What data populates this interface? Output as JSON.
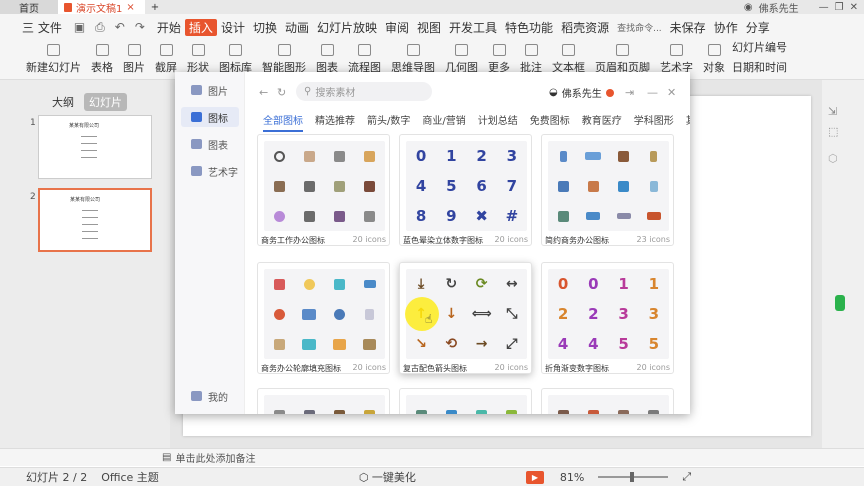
{
  "titlebar": {
    "home_tab": "首页",
    "doc_tab": "演示文稿1",
    "user": "佛系先生"
  },
  "menubar": {
    "file": "三 文件",
    "items": [
      "开始",
      "插入",
      "设计",
      "切换",
      "动画",
      "幻灯片放映",
      "审阅",
      "视图",
      "开发工具",
      "特色功能",
      "稻壳资源"
    ],
    "active": "插入",
    "search_placeholder": "查找命令...",
    "unsaved": "未保存",
    "collab": "协作",
    "share": "分享"
  },
  "ribbon": {
    "items": [
      "新建幻灯片",
      "表格",
      "图片",
      "截屏",
      "形状",
      "图标库",
      "智能图形",
      "图表",
      "流程图",
      "思维导图",
      "几何图",
      "更多",
      "批注",
      "文本框",
      "页眉和页脚",
      "艺术字",
      "对象"
    ],
    "right_top": "幻灯片编号",
    "right_bottom": "日期和时间"
  },
  "left_panel": {
    "tab_outline": "大纲",
    "tab_slides": "幻灯片",
    "thumb_title": "某某有限公司"
  },
  "notes": {
    "placeholder": "单击此处添加备注"
  },
  "status": {
    "slide_info": "幻灯片 2 / 2",
    "theme": "Office 主题",
    "beautify": "一键美化",
    "zoom": "81%"
  },
  "dialog": {
    "sidebar": [
      "图片",
      "图标",
      "图表",
      "艺术字"
    ],
    "sidebar_active": "图标",
    "sidebar_bottom": "我的",
    "search_placeholder": "搜索素材",
    "user": "佛系先生",
    "categories": [
      "全部图标",
      "精选推荐",
      "箭头/数字",
      "商业/营销",
      "计划总结",
      "免费图标",
      "教育医疗",
      "学科图形",
      "其他"
    ],
    "category_active": "全部图标",
    "cards": [
      {
        "name": "商务工作办公图标",
        "count": "20 icons",
        "kind": "office"
      },
      {
        "name": "蓝色晕染立体数字图标",
        "count": "20 icons",
        "kind": "digits",
        "glyphs": [
          "0",
          "1",
          "2",
          "3",
          "4",
          "5",
          "6",
          "7",
          "8",
          "9",
          "✖",
          "#"
        ]
      },
      {
        "name": "简约商务办公图标",
        "count": "23 icons",
        "kind": "biz"
      },
      {
        "name": "商务办公轮廓填充图标",
        "count": "20 icons",
        "kind": "outline"
      },
      {
        "name": "复古配色箭头图标",
        "count": "20 icons",
        "kind": "arrows",
        "glyphs": [
          "⤓",
          "↻",
          "⟳",
          "↔",
          "↑",
          "↓",
          "⟺",
          "⤡",
          "↘",
          "⟲",
          "→",
          "⤢"
        ]
      },
      {
        "name": "折角渐变数字图标",
        "count": "20 icons",
        "kind": "fold",
        "glyphs": [
          "0",
          "0",
          "1",
          "1",
          "2",
          "2",
          "3",
          "3",
          "4",
          "4",
          "5",
          "5"
        ]
      }
    ]
  }
}
